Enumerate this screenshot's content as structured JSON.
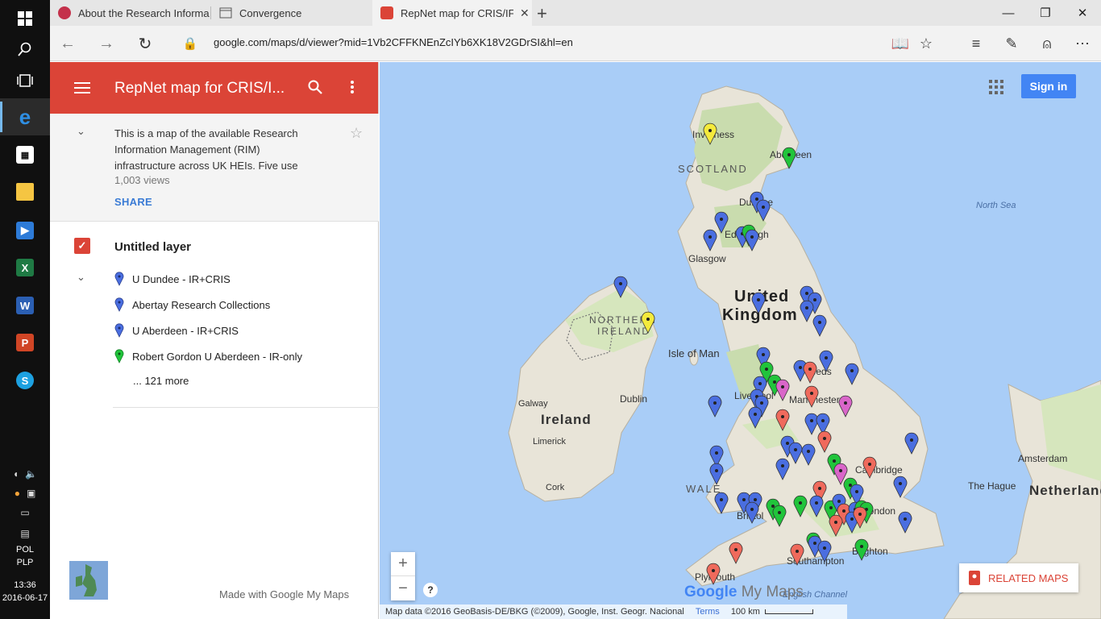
{
  "taskbar": {
    "time": "13:36",
    "date": "2016-06-17",
    "lang_top": "POL",
    "lang_bottom": "PLP"
  },
  "browser": {
    "tabs": [
      {
        "label": "About the Research Informa",
        "icon": "red-circle-icon"
      },
      {
        "label": "Convergence",
        "icon": "page-icon"
      },
      {
        "label": "RepNet map for CRIS/IF",
        "icon": "maps-pin-icon"
      }
    ],
    "url": "google.com/maps/d/viewer?mid=1Vb2CFFKNEnZcIYb6XK18V2GDrSI&hl=en"
  },
  "panel": {
    "title": "RepNet map for CRIS/I...",
    "description": "This is a map of the available Research Information Management (RIM) infrastructure across UK HEIs. Five use",
    "views": "1,003 views",
    "share": "SHARE",
    "layer_title": "Untitled layer",
    "features": [
      {
        "label": "U Dundee - IR+CRIS",
        "color": "#4a6ee0"
      },
      {
        "label": "Abertay Research Collections",
        "color": "#4a6ee0"
      },
      {
        "label": "U Aberdeen - IR+CRIS",
        "color": "#4a6ee0"
      },
      {
        "label": "Robert Gordon U Aberdeen - IR-only",
        "color": "#21c43b"
      }
    ],
    "more": "... 121 more",
    "made_with": "Made with Google My Maps"
  },
  "map": {
    "sign_in": "Sign in",
    "related_maps": "RELATED MAPS",
    "attribution": "Map data ©2016 GeoBasis-DE/BKG (©2009), Google, Inst. Geogr. Nacional",
    "terms": "Terms",
    "scale": "100 km",
    "brand_google": "Google",
    "brand_mymaps": "My Maps",
    "labels": {
      "scotland": "SCOTLAND",
      "uk_line1": "United",
      "uk_line2": "Kingdom",
      "ireland": "Ireland",
      "northern_ireland_1": "NORTHERN",
      "northern_ireland_2": "IRELAND",
      "north_sea": "North Sea",
      "isle_of_man": "Isle of Man",
      "netherlands": "Netherland",
      "wales": "WALE",
      "inverness": "Inverness",
      "aberdeen": "Aberdeen",
      "dundee": "Dundee",
      "edinburgh": "Edinburgh",
      "glasgow": "Glasgow",
      "dublin": "Dublin",
      "galway": "Galway",
      "limerick": "Limerick",
      "cork": "Cork",
      "liverpool": "Liverpool",
      "manchester": "Manchester",
      "leeds": "Leeds",
      "cambridge": "Cambridge",
      "amsterdam": "Amsterdam",
      "the_hague": "The Hague",
      "southampton": "Southampton",
      "brighton": "Brighton",
      "plymouth": "Plymouth",
      "bristol": "Bristol",
      "london": "London",
      "english_channel": "English Channel"
    },
    "pin_colors": {
      "blue": "#4a6ee0",
      "green": "#21c43b",
      "red": "#ef6a5c",
      "yellow": "#f4ea3c",
      "pink": "#d966c9"
    }
  }
}
